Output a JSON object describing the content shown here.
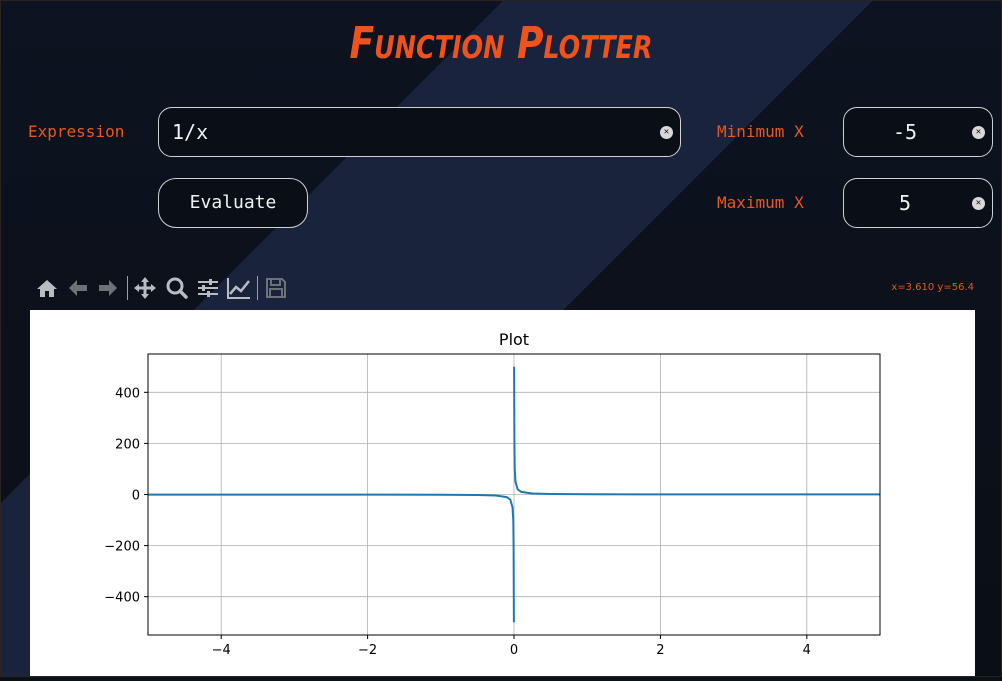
{
  "app": {
    "title": "Function Plotter"
  },
  "form": {
    "expression_label": "Expression",
    "expression_value": "1/x",
    "min_label": "Minimum X",
    "min_value": "-5",
    "max_label": "Maximum X",
    "max_value": "5",
    "evaluate_label": "Evaluate"
  },
  "toolbar": {
    "tools": [
      "home-icon",
      "back-icon",
      "forward-icon",
      "pan-icon",
      "zoom-icon",
      "configure-subplots-icon",
      "edit-axis-icon",
      "save-icon"
    ],
    "coord_readout": "x=3.610 y=56.4"
  },
  "colors": {
    "accent": "#f0521c",
    "label": "#e8581e",
    "line": "#1f77b4",
    "background": "#0b0f17"
  },
  "chart_data": {
    "type": "line",
    "title": "Plot",
    "xlabel": "",
    "ylabel": "",
    "expression": "1/x",
    "xlim": [
      -5,
      5
    ],
    "ylim": [
      -550,
      550
    ],
    "xticks": [
      -4,
      -2,
      0,
      2,
      4
    ],
    "xtick_labels": [
      "−4",
      "−2",
      "0",
      "2",
      "4"
    ],
    "yticks": [
      -400,
      -200,
      0,
      200,
      400
    ],
    "ytick_labels": [
      "−400",
      "−200",
      "0",
      "200",
      "400"
    ],
    "grid": true,
    "series": [
      {
        "color": "#1f77b4",
        "x": [
          -5,
          -4,
          -3,
          -2,
          -1,
          -0.5,
          -0.25,
          -0.1,
          -0.05,
          -0.02,
          -0.01,
          -0.005,
          -0.002,
          0.002,
          0.005,
          0.01,
          0.02,
          0.05,
          0.1,
          0.25,
          0.5,
          1,
          2,
          3,
          4,
          5
        ],
        "y": [
          -0.2,
          -0.25,
          -0.333,
          -0.5,
          -1,
          -2,
          -4,
          -10,
          -20,
          -50,
          -100,
          -200,
          -500,
          500,
          200,
          100,
          50,
          20,
          10,
          4,
          2,
          1,
          0.5,
          0.333,
          0.25,
          0.2
        ]
      }
    ]
  }
}
